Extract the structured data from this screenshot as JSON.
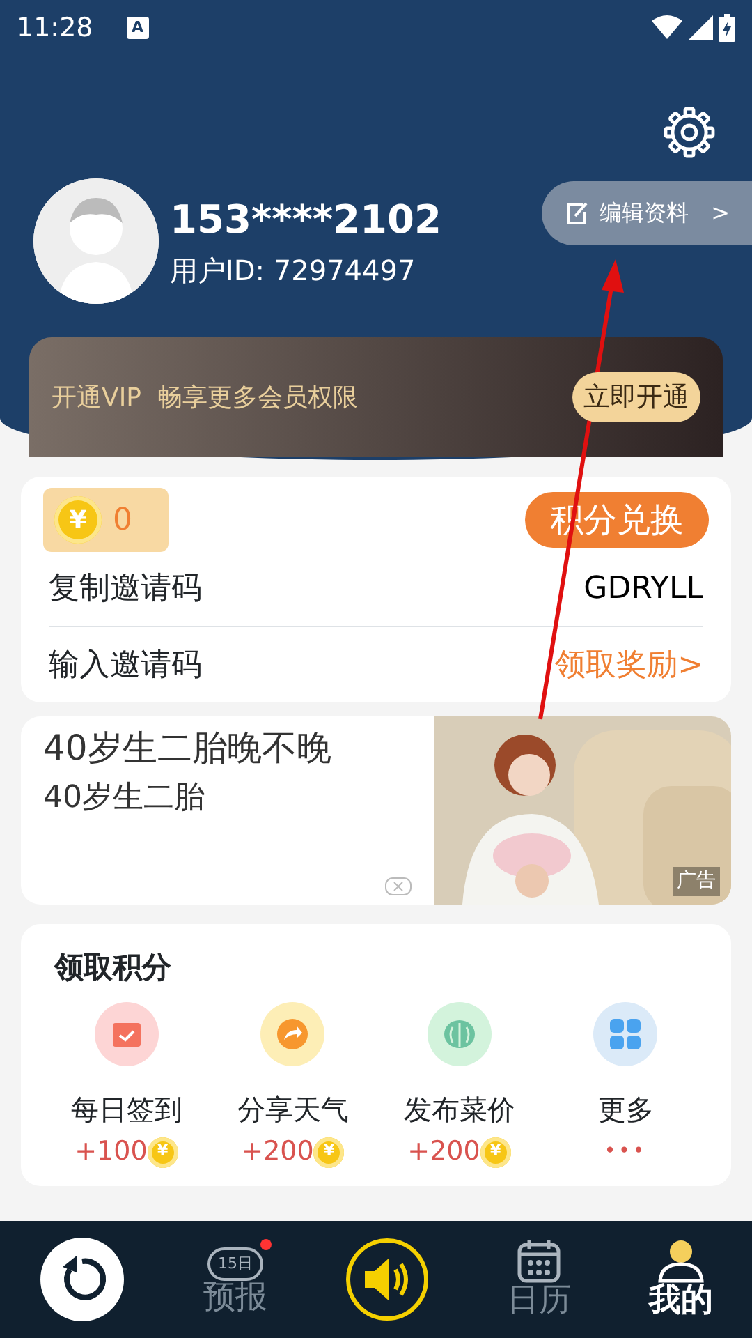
{
  "status_bar": {
    "time": "11:28",
    "notice_glyph": "A"
  },
  "profile": {
    "phone": "153****2102",
    "user_id": "用户ID: 72974497",
    "edit_button": "编辑资料",
    "edit_chevron": ">"
  },
  "vip": {
    "text": "开通VIP  畅享更多会员权限",
    "button": "立即开通"
  },
  "points": {
    "coin_symbol": "¥",
    "balance": "0",
    "exchange_button": "积分兑换"
  },
  "invite_rows": [
    {
      "label": "复制邀请码",
      "value": "GDRYLL",
      "kind": "code"
    },
    {
      "label": "输入邀请码",
      "value": "领取奖励>",
      "kind": "link"
    }
  ],
  "ad": {
    "title": "40岁生二胎晚不晚",
    "subtitle": "40岁生二胎",
    "tag": "广告",
    "kind": "picture"
  },
  "earn": {
    "title": "领取积分",
    "items": [
      {
        "label": "每日签到",
        "reward": "+100",
        "kind": "calendar",
        "color": "#fdd5d5"
      },
      {
        "label": "分享天气",
        "reward": "+200",
        "kind": "share",
        "color": "#fdeeb6"
      },
      {
        "label": "发布菜价",
        "reward": "+200",
        "kind": "cabbage",
        "color": "#d3f3dc"
      },
      {
        "label": "更多",
        "reward": "•••",
        "kind": "more",
        "color": "#dbeaf8"
      }
    ]
  },
  "bottom_nav": [
    {
      "kind": "refresh"
    },
    {
      "label": "预报",
      "kind": "forecast",
      "icon_text": "15日",
      "badge": true,
      "selected": false
    },
    {
      "kind": "sound"
    },
    {
      "label": "日历",
      "kind": "calendar",
      "selected": false
    },
    {
      "label": "我的",
      "kind": "profile",
      "selected": true
    }
  ]
}
